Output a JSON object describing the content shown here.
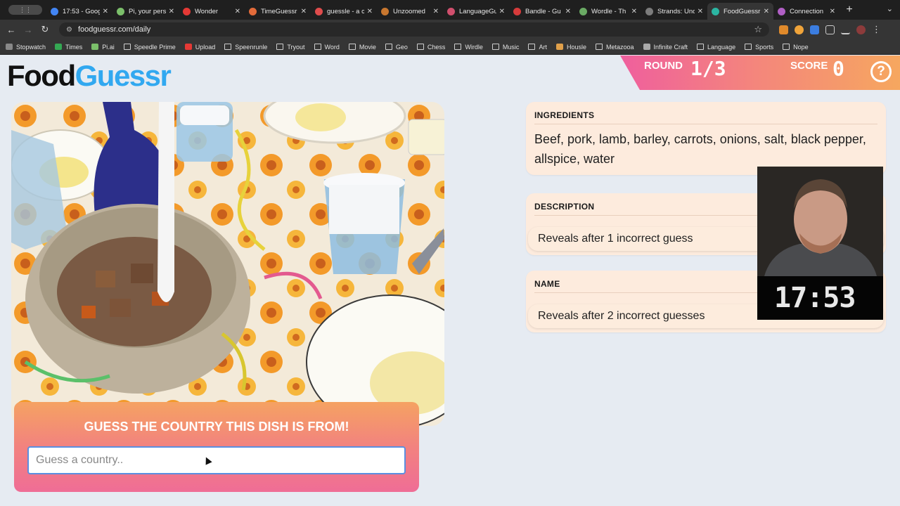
{
  "browser": {
    "first_tab": "⋮⋮",
    "tabs": [
      {
        "label": "17:53 - Goog",
        "color": "#4285f4"
      },
      {
        "label": "Pi, your pers",
        "color": "#7bbf6a"
      },
      {
        "label": "Wonder",
        "color": "#e53935"
      },
      {
        "label": "TimeGuessr",
        "color": "#e36b3a"
      },
      {
        "label": "guessle - a c",
        "color": "#e04c4c"
      },
      {
        "label": "Unzoomed",
        "color": "#c8772f"
      },
      {
        "label": "LanguageGu",
        "color": "#d04f6d"
      },
      {
        "label": "Bandle - Gu",
        "color": "#d63b3b"
      },
      {
        "label": "Wordle - Th",
        "color": "#6aaa64"
      },
      {
        "label": "Strands: Unc",
        "color": "#7c7c7c"
      },
      {
        "label": "FoodGuessr",
        "color": "#2bb5a2",
        "active": true
      },
      {
        "label": "Connection",
        "color": "#b05fc4"
      }
    ],
    "url": "foodguessr.com/daily",
    "bookmarks": [
      {
        "label": "Stopwatch",
        "icon": "stopwatch-icon",
        "color": "#888"
      },
      {
        "label": "Times",
        "icon": "sheet-icon",
        "color": "#34a853"
      },
      {
        "label": "Pi.ai",
        "icon": "pi-icon",
        "color": "#7bbf6a"
      },
      {
        "label": "Speedle Prime",
        "icon": "folder-icon"
      },
      {
        "label": "Upload",
        "icon": "youtube-icon",
        "color": "#e53935"
      },
      {
        "label": "Speenrunle",
        "icon": "folder-icon"
      },
      {
        "label": "Tryout",
        "icon": "folder-icon"
      },
      {
        "label": "Word",
        "icon": "folder-icon"
      },
      {
        "label": "Movie",
        "icon": "folder-icon"
      },
      {
        "label": "Geo",
        "icon": "folder-icon"
      },
      {
        "label": "Chess",
        "icon": "folder-icon"
      },
      {
        "label": "Wirdle",
        "icon": "folder-icon"
      },
      {
        "label": "Music",
        "icon": "folder-icon"
      },
      {
        "label": "Art",
        "icon": "folder-icon"
      },
      {
        "label": "Housle",
        "icon": "house-icon",
        "color": "#e0a04a"
      },
      {
        "label": "Metazooa",
        "icon": "folder-icon"
      },
      {
        "label": "Infinite Craft",
        "icon": "infinity-icon",
        "color": "#aaa"
      },
      {
        "label": "Language",
        "icon": "folder-icon"
      },
      {
        "label": "Sports",
        "icon": "folder-icon"
      },
      {
        "label": "Nope",
        "icon": "folder-icon"
      }
    ]
  },
  "header": {
    "logo_part1": "Food",
    "logo_part2": "Guessr",
    "round_label": "ROUND",
    "round_value": "1/3",
    "score_label": "SCORE",
    "score_value": "0",
    "help_symbol": "?"
  },
  "guess": {
    "title": "GUESS THE COUNTRY THIS DISH IS FROM!",
    "placeholder": "Guess a country.."
  },
  "clues": {
    "ingredients_heading": "INGREDIENTS",
    "ingredients_text": "Beef, pork, lamb, barley, carrots, onions, salt, black pepper, allspice, water",
    "description_heading": "DESCRIPTION",
    "description_text": "Reveals after 1 incorrect guess",
    "name_heading": "NAME",
    "name_text": "Reveals after 2 incorrect guesses"
  },
  "webcam": {
    "time": "17:53 -"
  },
  "colors": {
    "brand_blue": "#31a8f0",
    "banner_pink": "#ef5f9d",
    "banner_orange": "#f6a75f",
    "card_bg": "#fdebdd"
  }
}
